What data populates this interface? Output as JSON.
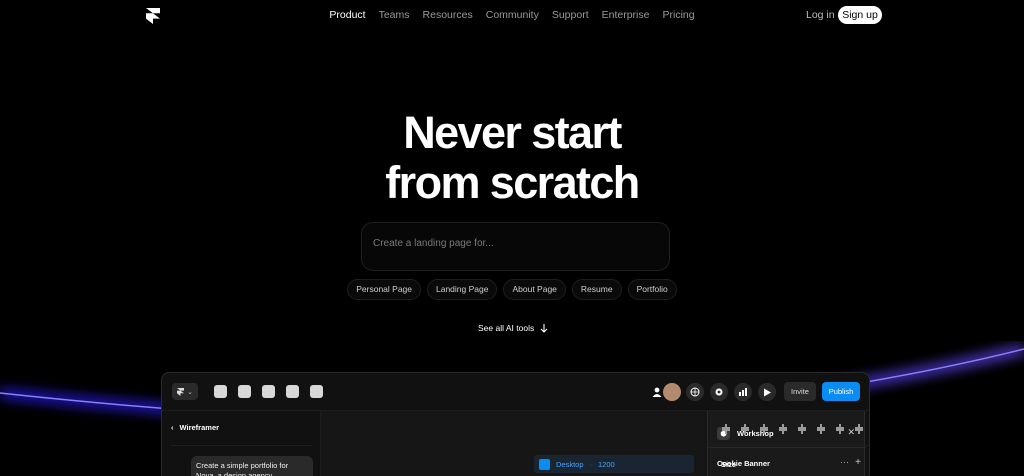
{
  "nav": {
    "items": [
      {
        "label": "Product",
        "active": true
      },
      {
        "label": "Teams",
        "active": false
      },
      {
        "label": "Resources",
        "active": false
      },
      {
        "label": "Community",
        "active": false
      },
      {
        "label": "Support",
        "active": false
      },
      {
        "label": "Enterprise",
        "active": false
      },
      {
        "label": "Pricing",
        "active": false
      }
    ],
    "login": "Log in",
    "signup": "Sign up"
  },
  "hero": {
    "title_line1": "Never start",
    "title_line2": "from scratch",
    "prompt_placeholder": "Create a landing page for...",
    "chips": [
      "Personal Page",
      "Landing Page",
      "About Page",
      "Resume",
      "Portfolio"
    ],
    "see_all": "See all AI tools"
  },
  "app": {
    "toolbar": {
      "invite": "Invite",
      "publish": "Publish"
    },
    "left_panel": {
      "title": "Wireframer",
      "message": "Create a simple portfolio for Nova, a design agency"
    },
    "canvas": {
      "breakpoint": "Desktop",
      "width": "1200"
    },
    "workshop": {
      "title": "Workshop",
      "item": "Cookie Banner"
    },
    "right_panel": {
      "size_label": "Size"
    }
  },
  "colors": {
    "accent": "#0a8cf2",
    "glow": "#5b3cff",
    "background": "#000000"
  }
}
